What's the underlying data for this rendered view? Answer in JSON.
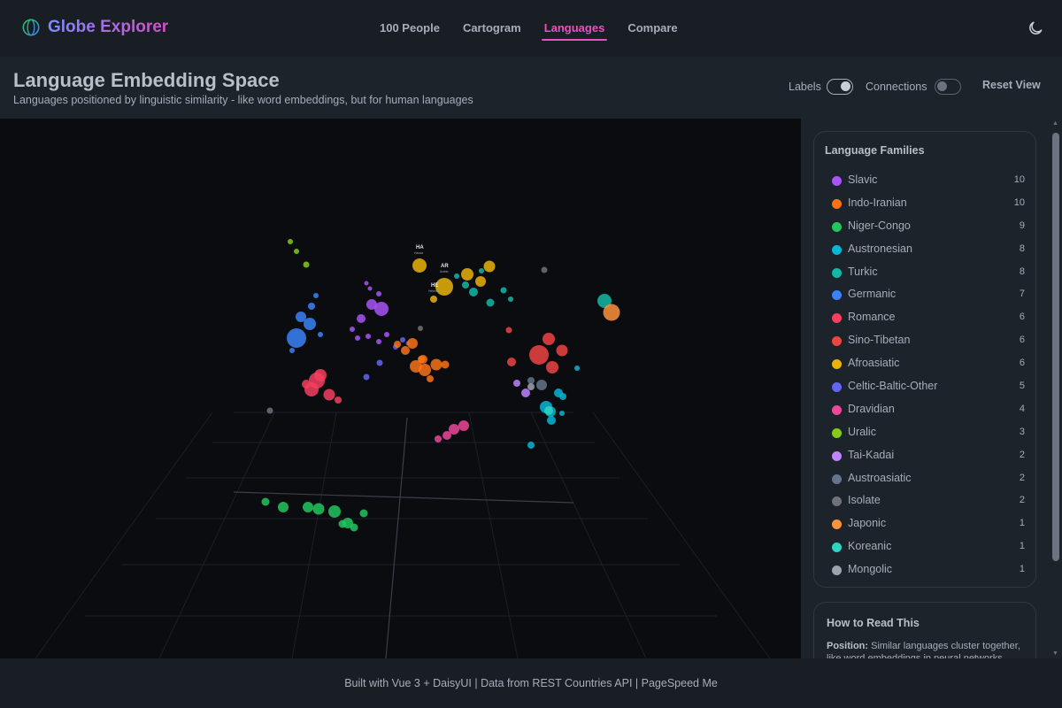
{
  "app": {
    "title": "Globe Explorer"
  },
  "nav": {
    "items": [
      {
        "label": "100 People",
        "active": false
      },
      {
        "label": "Cartogram",
        "active": false
      },
      {
        "label": "Languages",
        "active": true
      },
      {
        "label": "Compare",
        "active": false
      }
    ],
    "theme_icon": "moon-icon"
  },
  "header": {
    "title": "Language Embedding Space",
    "subtitle": "Languages positioned by linguistic similarity - like word embeddings, but for human languages"
  },
  "controls": {
    "labels_label": "Labels",
    "labels_on": true,
    "connections_label": "Connections",
    "connections_on": false,
    "reset_label": "Reset View"
  },
  "scene": {
    "point_labels": [
      {
        "code": "HA",
        "name": "Hausa"
      },
      {
        "code": "AR",
        "name": "Arabic"
      },
      {
        "code": "HE",
        "name": "Hebrew"
      }
    ]
  },
  "families": {
    "title": "Language Families",
    "items": [
      {
        "name": "Slavic",
        "count": "10",
        "color": "#a855f7"
      },
      {
        "name": "Indo-Iranian",
        "count": "10",
        "color": "#f97316"
      },
      {
        "name": "Niger-Congo",
        "count": "9",
        "color": "#22c55e"
      },
      {
        "name": "Austronesian",
        "count": "8",
        "color": "#06b6d4"
      },
      {
        "name": "Turkic",
        "count": "8",
        "color": "#14b8a6"
      },
      {
        "name": "Germanic",
        "count": "7",
        "color": "#3b82f6"
      },
      {
        "name": "Romance",
        "count": "6",
        "color": "#f43f5e"
      },
      {
        "name": "Sino-Tibetan",
        "count": "6",
        "color": "#ef4444"
      },
      {
        "name": "Afroasiatic",
        "count": "6",
        "color": "#eab308"
      },
      {
        "name": "Celtic-Baltic-Other",
        "count": "5",
        "color": "#6366f1"
      },
      {
        "name": "Dravidian",
        "count": "4",
        "color": "#ec4899"
      },
      {
        "name": "Uralic",
        "count": "3",
        "color": "#84cc16"
      },
      {
        "name": "Tai-Kadai",
        "count": "2",
        "color": "#c084fc"
      },
      {
        "name": "Austroasiatic",
        "count": "2",
        "color": "#64748b"
      },
      {
        "name": "Isolate",
        "count": "2",
        "color": "#71717a"
      },
      {
        "name": "Japonic",
        "count": "1",
        "color": "#fb923c"
      },
      {
        "name": "Koreanic",
        "count": "1",
        "color": "#2dd4bf"
      },
      {
        "name": "Mongolic",
        "count": "1",
        "color": "#9ca3af"
      }
    ]
  },
  "howto": {
    "title": "How to Read This",
    "position_label": "Position:",
    "position_text": "Similar languages cluster together, like word embeddings in neural networks."
  },
  "footer": {
    "text": "Built with Vue 3 + DaisyUI | Data from REST Countries API | PageSpeed Me"
  }
}
